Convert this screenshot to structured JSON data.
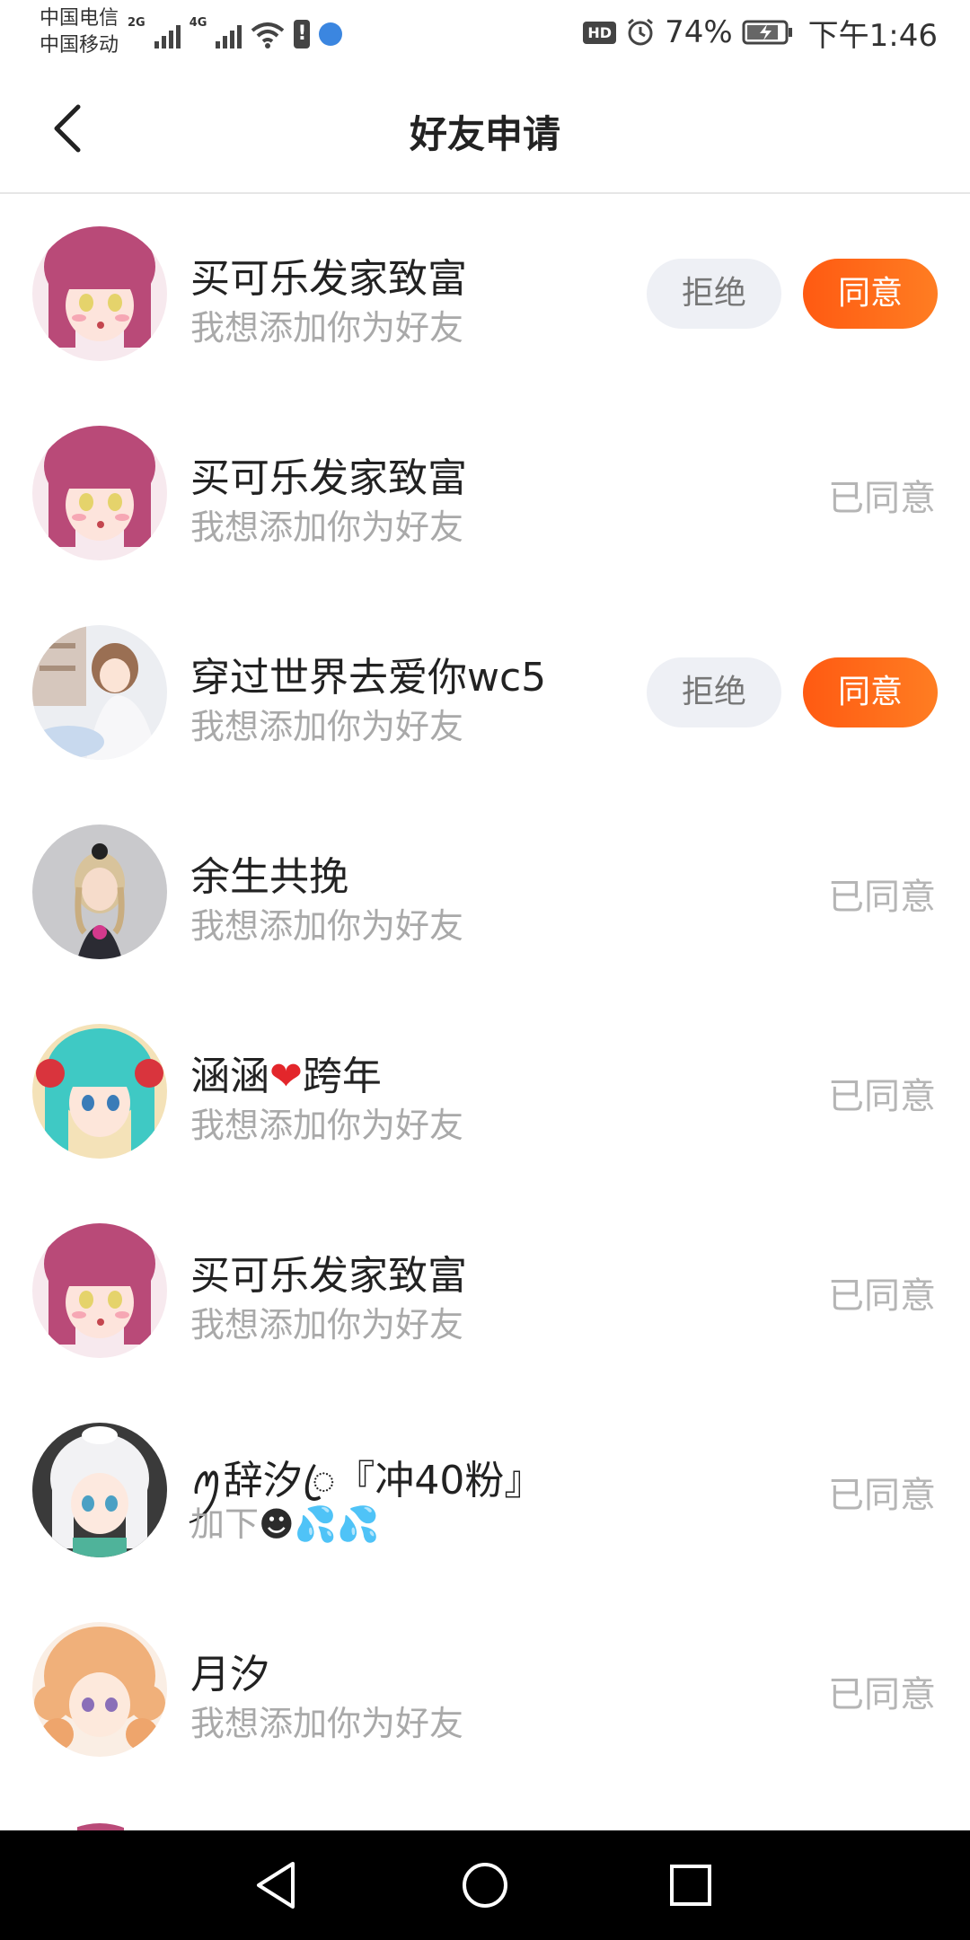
{
  "status_bar": {
    "carrier_1": "中国电信",
    "carrier_2": "中国移动",
    "net_1": "2G",
    "net_2": "4G",
    "hd": "HD",
    "battery": "74%",
    "time": "下午1:46"
  },
  "header": {
    "title": "好友申请",
    "back_icon": "chevron-left-icon"
  },
  "actions": {
    "reject_label": "拒绝",
    "accept_label": "同意",
    "agreed_label": "已同意"
  },
  "requests": [
    {
      "name": "买可乐发家致富",
      "message": "我想添加你为好友",
      "state": "pending",
      "avatar_color": "#b94a78"
    },
    {
      "name": "买可乐发家致富",
      "message": "我想添加你为好友",
      "state": "agreed",
      "avatar_color": "#b94a78"
    },
    {
      "name": "穿过世界去爱你wc5",
      "message": "我想添加你为好友",
      "state": "pending",
      "avatar_color": "#c9a58a"
    },
    {
      "name": "余生共挽",
      "message": "我想添加你为好友",
      "state": "agreed",
      "avatar_color": "#c9c9cc"
    },
    {
      "name_part1": "涵涵",
      "name_emoji": "❤",
      "name_part2": "跨年",
      "message": "我想添加你为好友",
      "state": "agreed",
      "avatar_color": "#3fc9c4"
    },
    {
      "name": "买可乐发家致富",
      "message": "我想添加你为好友",
      "state": "agreed",
      "avatar_color": "#b94a78"
    },
    {
      "name": "ꪑ辞汐ꦿ『冲40粉』",
      "message": "加下",
      "message_emoji": "☻💦💦",
      "state": "agreed",
      "avatar_color": "#e8e8ea"
    },
    {
      "name": "月汐",
      "message": "我想添加你为好友",
      "state": "agreed",
      "avatar_color": "#f0b07a"
    }
  ],
  "nav_bar": {
    "back_icon": "triangle-back-icon",
    "home_icon": "circle-home-icon",
    "recent_icon": "square-recents-icon"
  },
  "colors": {
    "accent": "#ff6a1a",
    "reject_bg": "#eef0f5",
    "muted_text": "#a9a9a9"
  }
}
